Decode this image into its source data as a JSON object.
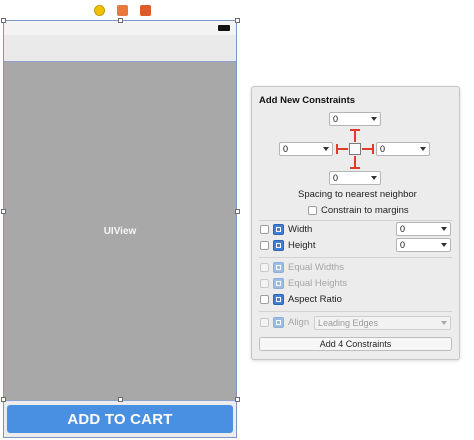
{
  "scene": {
    "dock_icons": [
      "view-controller-icon",
      "first-responder-icon",
      "exit-icon"
    ],
    "uiview_label": "UIView",
    "cart_button_label": "ADD TO CART"
  },
  "popover": {
    "title": "Add New Constraints",
    "spacing": {
      "top": "0",
      "left": "0",
      "right": "0",
      "bottom": "0"
    },
    "spacing_caption": "Spacing to nearest neighbor",
    "constrain_margins_label": "Constrain to margins",
    "width_label": "Width",
    "width_value": "0",
    "height_label": "Height",
    "height_value": "0",
    "equal_widths_label": "Equal Widths",
    "equal_heights_label": "Equal Heights",
    "aspect_ratio_label": "Aspect Ratio",
    "align_label": "Align",
    "align_value": "Leading Edges",
    "add_button_label": "Add 4 Constraints"
  },
  "colors": {
    "accent": "#4a90e2",
    "constraint_red": "#e23b2e",
    "uiview_gray": "#a8a8a8"
  }
}
